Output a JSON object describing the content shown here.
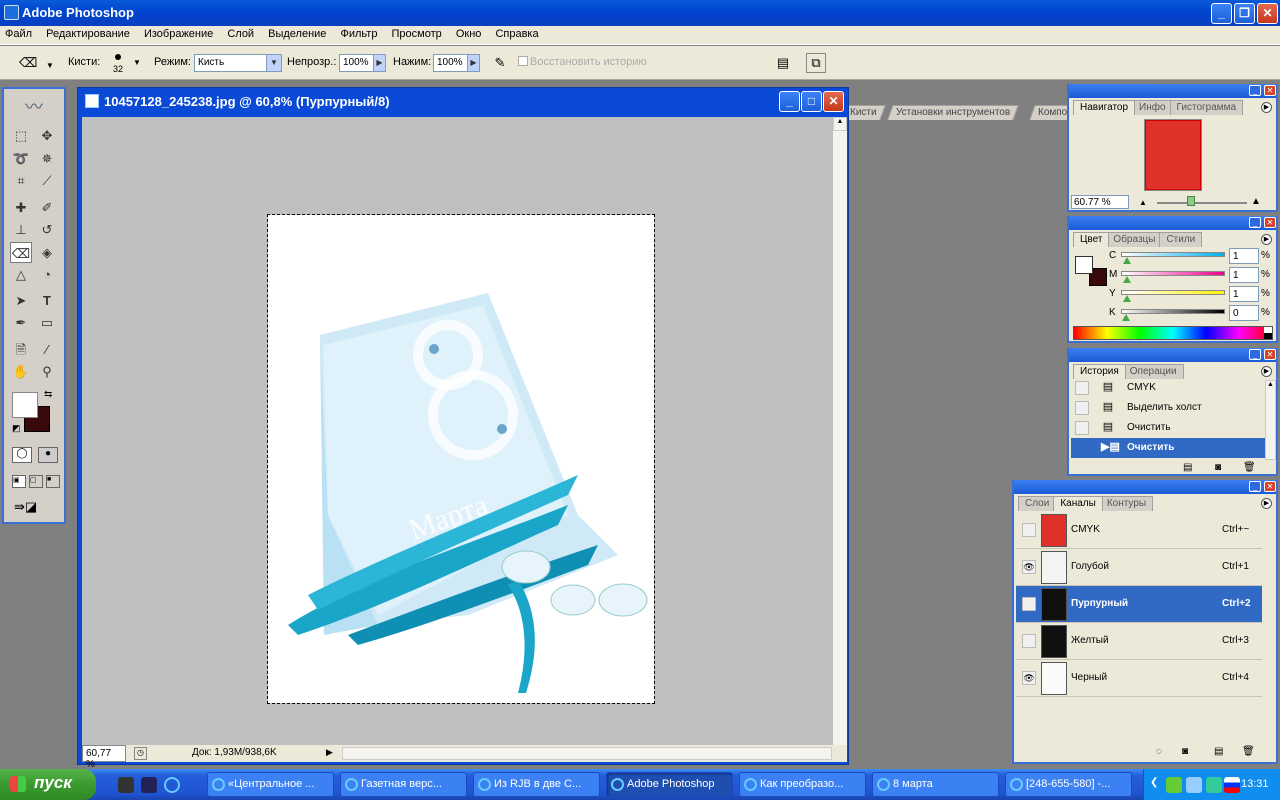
{
  "app": {
    "title": "Adobe Photoshop"
  },
  "menu": [
    "Файл",
    "Редактирование",
    "Изображение",
    "Слой",
    "Выделение",
    "Фильтр",
    "Просмотр",
    "Окно",
    "Справка"
  ],
  "options": {
    "brush_label": "Кисти:",
    "brush_size": "32",
    "mode_label": "Режим:",
    "mode_value": "Кисть",
    "opacity_label": "Непрозр.:",
    "opacity_value": "100%",
    "flow_label": "Нажим:",
    "flow_value": "100%",
    "restore_history": "Восстановить историю"
  },
  "palette_well": [
    "Кисти",
    "Установки инструментов",
    "Композиции слоев"
  ],
  "document": {
    "title": "10457128_245238.jpg @ 60,8% (Пурпурный/8)",
    "zoom": "60,77 %",
    "doc_size": "Док: 1,93M/938,6K"
  },
  "navigator": {
    "tabs": [
      "Навигатор",
      "Инфо",
      "Гистограмма"
    ],
    "zoom": "60.77 %"
  },
  "color": {
    "tabs": [
      "Цвет",
      "Образцы",
      "Стили"
    ],
    "channels": [
      {
        "label": "C",
        "value": "1",
        "fill": 0.01,
        "gradient": "linear-gradient(90deg,#fff,#00aeef)"
      },
      {
        "label": "M",
        "value": "1",
        "fill": 0.01,
        "gradient": "linear-gradient(90deg,#fff,#ec008c)"
      },
      {
        "label": "Y",
        "value": "1",
        "fill": 0.01,
        "gradient": "linear-gradient(90deg,#fff,#fff200)"
      },
      {
        "label": "K",
        "value": "0",
        "fill": 0.0,
        "gradient": "linear-gradient(90deg,#fff,#000)"
      }
    ],
    "pct": "%"
  },
  "history": {
    "tabs": [
      "История",
      "Операции"
    ],
    "items": [
      "CMYK",
      "Выделить холст",
      "Очистить",
      "Очистить"
    ]
  },
  "channels": {
    "tabs": [
      "Слои",
      "Каналы",
      "Контуры"
    ],
    "rows": [
      {
        "name": "CMYK",
        "shortcut": "Ctrl+~",
        "eye": "",
        "thumb": "#e0302a",
        "selected": false
      },
      {
        "name": "Голубой",
        "shortcut": "Ctrl+1",
        "eye": "👁",
        "thumb": "#f4f4f4",
        "selected": false
      },
      {
        "name": "Пурпурный",
        "shortcut": "Ctrl+2",
        "eye": "",
        "thumb": "#101010",
        "selected": true
      },
      {
        "name": "Желтый",
        "shortcut": "Ctrl+3",
        "eye": "",
        "thumb": "#101010",
        "selected": false
      },
      {
        "name": "Черный",
        "shortcut": "Ctrl+4",
        "eye": "👁",
        "thumb": "#fafafa",
        "selected": false
      }
    ]
  },
  "taskbar": {
    "start": "пуск",
    "tasks": [
      "«Центральное ...",
      "Газетная верс...",
      "Из RJB в две С...",
      "Adobe Photoshop",
      "Как преобразо...",
      "8 марта",
      "[248-655-580] -..."
    ],
    "active": 3,
    "clock": "13:31"
  },
  "colors": {
    "accent": "#316ac5",
    "xp_blue": "#0a5ad8",
    "canvas_gray": "#c0c0c0",
    "foreground": "#ffffff",
    "background": "#3a0a0a"
  }
}
